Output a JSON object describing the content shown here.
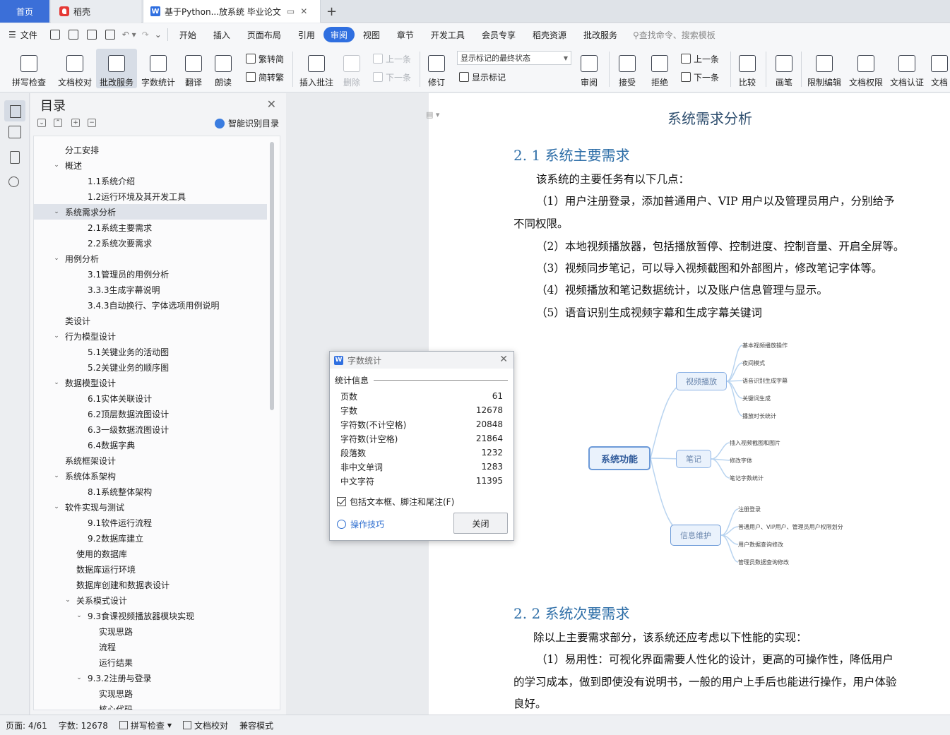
{
  "tabs": {
    "home": "首页",
    "daoke": "稻壳",
    "doc": "基于Python...放系统 毕业论文",
    "add": "+"
  },
  "menu": {
    "file": "文件",
    "items": [
      "开始",
      "插入",
      "页面布局",
      "引用",
      "审阅",
      "视图",
      "章节",
      "开发工具",
      "会员专享",
      "稻壳资源",
      "批改服务"
    ],
    "active": "审阅",
    "search": "查找命令、搜索模板"
  },
  "ribbon": {
    "spell": "拼写检查",
    "proof": "文档校对",
    "review_service": "批改服务",
    "word_count": "字数统计",
    "translate": "翻译",
    "read": "朗读",
    "trad": "繁转简",
    "simp": "简转繁",
    "insert_comment": "插入批注",
    "delete": "删除",
    "prev_comment": "上一条",
    "next_comment": "下一条",
    "track": "修订",
    "markup_state": "显示标记的最终状态",
    "show_markup": "显示标记",
    "review_pane": "审阅",
    "accept": "接受",
    "reject": "拒绝",
    "prev": "上一条",
    "next": "下一条",
    "compare": "比较",
    "pen": "画笔",
    "restrict": "限制编辑",
    "permission": "文档权限",
    "cert": "文档认证",
    "more": "文档"
  },
  "toc": {
    "title": "目录",
    "smart": "智能识别目录",
    "items": [
      {
        "label": "分工安排",
        "level": 1,
        "caret": ""
      },
      {
        "label": "概述",
        "level": 1,
        "caret": "v"
      },
      {
        "label": "1.1系统介绍",
        "level": 3,
        "caret": ""
      },
      {
        "label": "1.2运行环境及其开发工具",
        "level": 3,
        "caret": ""
      },
      {
        "label": "系统需求分析",
        "level": 1,
        "caret": "v",
        "selected": true
      },
      {
        "label": "2.1系统主要需求",
        "level": 3,
        "caret": ""
      },
      {
        "label": "2.2系统次要需求",
        "level": 3,
        "caret": ""
      },
      {
        "label": "用例分析",
        "level": 1,
        "caret": "v"
      },
      {
        "label": "3.1管理员的用例分析",
        "level": 3,
        "caret": ""
      },
      {
        "label": "3.3.3生成字幕说明",
        "level": 3,
        "caret": ""
      },
      {
        "label": "3.4.3自动换行、字体选项用例说明",
        "level": 3,
        "caret": ""
      },
      {
        "label": "类设计",
        "level": 1,
        "caret": ""
      },
      {
        "label": "行为模型设计",
        "level": 1,
        "caret": "v"
      },
      {
        "label": "5.1关键业务的活动图",
        "level": 3,
        "caret": ""
      },
      {
        "label": "5.2关键业务的顺序图",
        "level": 3,
        "caret": ""
      },
      {
        "label": "数据模型设计",
        "level": 1,
        "caret": "v"
      },
      {
        "label": "6.1实体关联设计",
        "level": 3,
        "caret": ""
      },
      {
        "label": "6.2顶层数据流图设计",
        "level": 3,
        "caret": ""
      },
      {
        "label": "6.3一级数据流图设计",
        "level": 3,
        "caret": ""
      },
      {
        "label": "6.4数据字典",
        "level": 3,
        "caret": ""
      },
      {
        "label": "系统框架设计",
        "level": 1,
        "caret": ""
      },
      {
        "label": "系统体系架构",
        "level": 1,
        "caret": "v"
      },
      {
        "label": "8.1系统整体架构",
        "level": 3,
        "caret": ""
      },
      {
        "label": "软件实现与测试",
        "level": 1,
        "caret": "v"
      },
      {
        "label": "9.1软件运行流程",
        "level": 3,
        "caret": ""
      },
      {
        "label": "9.2数据库建立",
        "level": 3,
        "caret": ""
      },
      {
        "label": "使用的数据库",
        "level": 2,
        "caret": ""
      },
      {
        "label": "数据库运行环境",
        "level": 2,
        "caret": ""
      },
      {
        "label": "数据库创建和数据表设计",
        "level": 2,
        "caret": ""
      },
      {
        "label": "关系模式设计",
        "level": 2,
        "caret": "v"
      },
      {
        "label": "9.3食课视频播放器模块实现",
        "level": 3,
        "caret": "v"
      },
      {
        "label": "实现思路",
        "level": 4,
        "caret": ""
      },
      {
        "label": "流程",
        "level": 4,
        "caret": ""
      },
      {
        "label": "运行结果",
        "level": 4,
        "caret": ""
      },
      {
        "label": "9.3.2注册与登录",
        "level": 3,
        "caret": "v"
      },
      {
        "label": "实现思路",
        "level": 4,
        "caret": ""
      },
      {
        "label": "核心代码",
        "level": 4,
        "caret": ""
      }
    ]
  },
  "doc": {
    "chapter": "系统需求分析",
    "h2_1": "2. 1 系统主要需求",
    "p_intro": "该系统的主要任务有以下几点：",
    "items": [
      "（1）用户注册登录，添加普通用户、VIP 用户以及管理员用户，分别给予",
      "不同权限。",
      "（2）本地视频播放器，包括播放暂停、控制进度、控制音量、开启全屏等。",
      "（3）视频同步笔记，可以导入视频截图和外部图片，修改笔记字体等。",
      "（4）视频播放和笔记数据统计，以及账户信息管理与显示。",
      "（5）语音识别生成视频字幕和生成字幕关键词"
    ],
    "h2_2": "2. 2 系统次要需求",
    "p2_intro": "除以上主要需求部分，该系统还应考虑以下性能的实现：",
    "p2_lines": [
      "（1）易用性：可视化界面需要人性化的设计，更高的可操作性，降低用户",
      "的学习成本，做到即使没有说明书，一般的用户上手后也能进行操作，用户体验",
      "良好。"
    ]
  },
  "mindmap": {
    "root": "系统功能",
    "branches": [
      {
        "label": "视频播放",
        "leaves": [
          "基本视频播放操作",
          "夜间模式",
          "语音识别生成字幕",
          "关键词生成",
          "播放时长统计"
        ]
      },
      {
        "label": "笔记",
        "leaves": [
          "插入视频截图和图片",
          "修改字体",
          "笔记字数统计"
        ]
      },
      {
        "label": "信息维护",
        "leaves": [
          "注册登录",
          "普通用户、VIP用户、管理员用户权限划分",
          "用户数据查询修改",
          "管理员数据查询修改"
        ]
      }
    ]
  },
  "dialog": {
    "title": "字数统计",
    "section": "统计信息",
    "rows": [
      {
        "label": "页数",
        "value": "61"
      },
      {
        "label": "字数",
        "value": "12678"
      },
      {
        "label": "字符数(不计空格)",
        "value": "20848"
      },
      {
        "label": "字符数(计空格)",
        "value": "21864"
      },
      {
        "label": "段落数",
        "value": "1232"
      },
      {
        "label": "非中文单词",
        "value": "1283"
      },
      {
        "label": "中文字符",
        "value": "11395"
      }
    ],
    "checkbox": "包括文本框、脚注和尾注(F)",
    "tips": "操作技巧",
    "close": "关闭"
  },
  "status": {
    "page": "页面: 4/61",
    "words": "字数: 12678",
    "spell": "拼写检查",
    "proof": "文档校对",
    "compat": "兼容模式"
  }
}
